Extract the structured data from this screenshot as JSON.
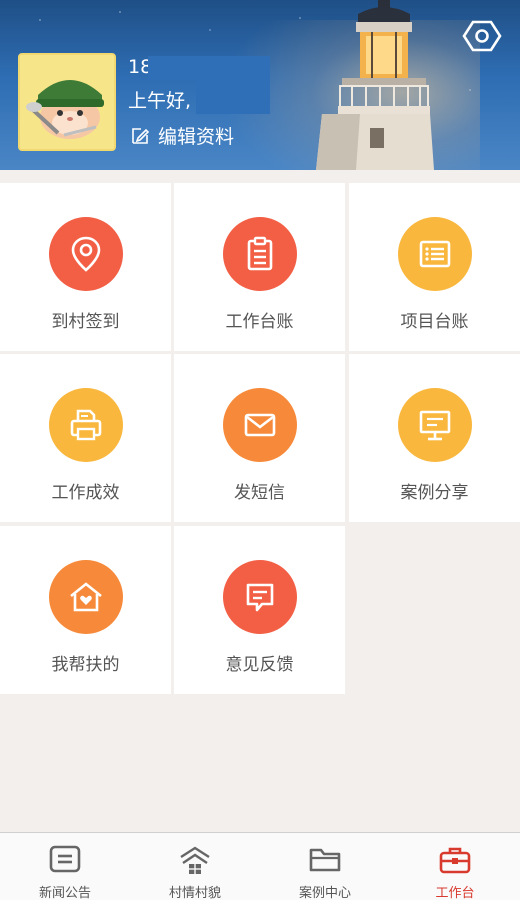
{
  "header": {
    "user_number": "18",
    "greeting": "上午好,",
    "edit_profile": "编辑资料",
    "settings_icon": "settings-hexagon-icon"
  },
  "grid": {
    "items": [
      {
        "label": "到村签到",
        "icon": "location-pin-icon",
        "color": "#f25f45"
      },
      {
        "label": "工作台账",
        "icon": "clipboard-icon",
        "color": "#f25f45"
      },
      {
        "label": "项目台账",
        "icon": "list-document-icon",
        "color": "#f9b73d"
      },
      {
        "label": "工作成效",
        "icon": "printer-icon",
        "color": "#f9b73d"
      },
      {
        "label": "发短信",
        "icon": "envelope-icon",
        "color": "#f78a3a"
      },
      {
        "label": "案例分享",
        "icon": "presentation-board-icon",
        "color": "#f9b73d"
      },
      {
        "label": "我帮扶的",
        "icon": "house-heart-icon",
        "color": "#f78a3a"
      },
      {
        "label": "意见反馈",
        "icon": "feedback-message-icon",
        "color": "#f25f45"
      }
    ]
  },
  "tabbar": {
    "tabs": [
      {
        "label": "新闻公告",
        "icon": "news-icon",
        "active": false
      },
      {
        "label": "村情村貌",
        "icon": "village-house-icon",
        "active": false
      },
      {
        "label": "案例中心",
        "icon": "folder-icon",
        "active": false
      },
      {
        "label": "工作台",
        "icon": "toolbox-icon",
        "active": true
      }
    ],
    "active_color": "#d93a2e"
  }
}
